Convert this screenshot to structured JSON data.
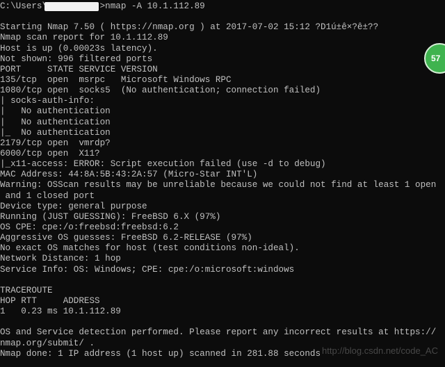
{
  "terminal": {
    "lines": [
      "C:\\Users\\          >nmap -A 10.1.112.89",
      "",
      "Starting Nmap 7.50 ( https://nmap.org ) at 2017-07-02 15:12 ?D1ú±ê×?ê±??",
      "Nmap scan report for 10.1.112.89",
      "Host is up (0.00023s latency).",
      "Not shown: 996 filtered ports",
      "PORT     STATE SERVICE VERSION",
      "135/tcp  open  msrpc   Microsoft Windows RPC",
      "1080/tcp open  socks5  (No authentication; connection failed)",
      "| socks-auth-info:",
      "|   No authentication",
      "|   No authentication",
      "|_  No authentication",
      "2179/tcp open  vmrdp?",
      "6000/tcp open  X11?",
      "|_x11-access: ERROR: Script execution failed (use -d to debug)",
      "MAC Address: 44:8A:5B:43:2A:57 (Micro-Star INT'L)",
      "Warning: OSScan results may be unreliable because we could not find at least 1 open",
      " and 1 closed port",
      "Device type: general purpose",
      "Running (JUST GUESSING): FreeBSD 6.X (97%)",
      "OS CPE: cpe:/o:freebsd:freebsd:6.2",
      "Aggressive OS guesses: FreeBSD 6.2-RELEASE (97%)",
      "No exact OS matches for host (test conditions non-ideal).",
      "Network Distance: 1 hop",
      "Service Info: OS: Windows; CPE: cpe:/o:microsoft:windows",
      "",
      "TRACEROUTE",
      "HOP RTT     ADDRESS",
      "1   0.23 ms 10.1.112.89",
      "",
      "OS and Service detection performed. Please report any incorrect results at https://",
      "nmap.org/submit/ .",
      "Nmap done: 1 IP address (1 host up) scanned in 281.88 seconds"
    ]
  },
  "watermark": "http://blog.csdn.net/code_AC",
  "badge": "57",
  "colors": {
    "background": "#0c0c0c",
    "text": "#c0c0c0",
    "badge": "#3fb34f"
  }
}
